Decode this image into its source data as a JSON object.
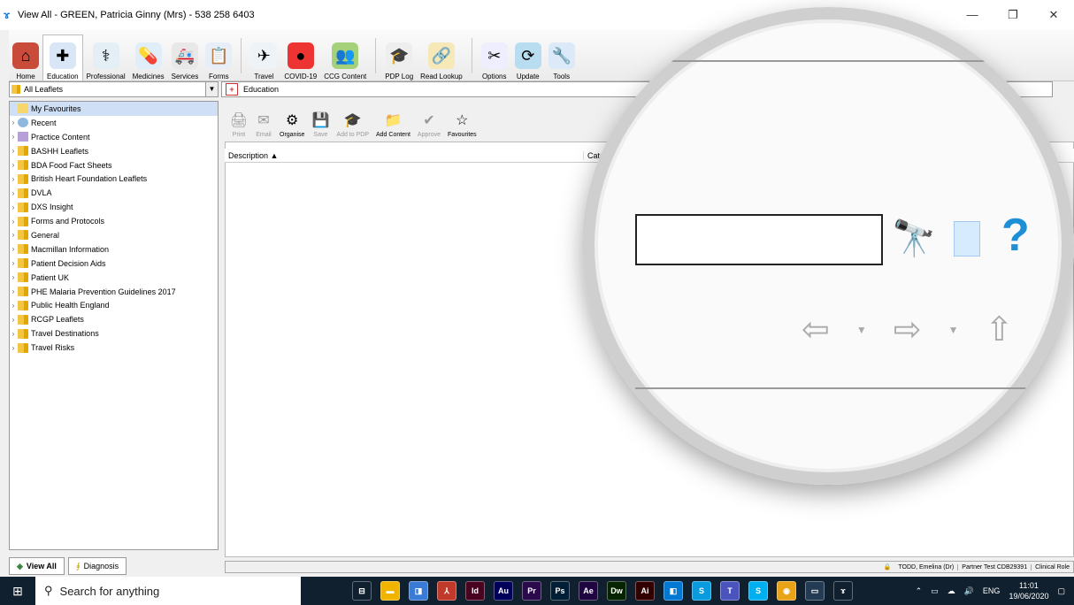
{
  "window": {
    "title": "View All  -  GREEN, Patricia Ginny (Mrs) - 538 258 6403",
    "buttons": [
      "—",
      "❐",
      "✕"
    ]
  },
  "ribbon": [
    {
      "label": "Home",
      "color": "#c94b3a",
      "glyph": "⌂"
    },
    {
      "label": "Education",
      "color": "#d8e6f5",
      "glyph": "✚",
      "active": true
    },
    {
      "label": "Professional",
      "color": "#e4eef5",
      "glyph": "⚕"
    },
    {
      "label": "Medicines",
      "color": "#dfeef8",
      "glyph": "💊"
    },
    {
      "label": "Services",
      "color": "#e8e8e8",
      "glyph": "🚑"
    },
    {
      "label": "Forms",
      "color": "#e8eef8",
      "glyph": "📋"
    },
    {
      "label": "Travel",
      "color": "#eef3f8",
      "glyph": "✈"
    },
    {
      "label": "COVID-19",
      "color": "#e33",
      "glyph": "●"
    },
    {
      "label": "CCG Content",
      "color": "#a6d17b",
      "glyph": "👥"
    },
    {
      "label": "PDP Log",
      "color": "#eee",
      "glyph": "🎓"
    },
    {
      "label": "Read Lookup",
      "color": "#f7e9b7",
      "glyph": "🔗"
    },
    {
      "label": "Options",
      "color": "#eef",
      "glyph": "✂"
    },
    {
      "label": "Update",
      "color": "#b8dcf0",
      "glyph": "⟳"
    },
    {
      "label": "Tools",
      "color": "#dbe9f8",
      "glyph": "🔧"
    }
  ],
  "leftPanel": {
    "combo": "All Leaflets",
    "tree": [
      {
        "label": "My Favourites",
        "type": "fav",
        "selected": true
      },
      {
        "label": "Recent",
        "type": "recent"
      },
      {
        "label": "Practice Content",
        "type": "practice"
      },
      {
        "label": "BASHH Leaflets",
        "type": "folder"
      },
      {
        "label": "BDA Food Fact Sheets",
        "type": "folder"
      },
      {
        "label": "British Heart Foundation Leaflets",
        "type": "folder"
      },
      {
        "label": "DVLA",
        "type": "folder"
      },
      {
        "label": "DXS Insight",
        "type": "folder"
      },
      {
        "label": "Forms and Protocols",
        "type": "folder"
      },
      {
        "label": "General",
        "type": "folder"
      },
      {
        "label": "Macmillan Information",
        "type": "folder"
      },
      {
        "label": "Patient Decision Aids",
        "type": "folder"
      },
      {
        "label": "Patient UK",
        "type": "folder"
      },
      {
        "label": "PHE Malaria Prevention Guidelines 2017",
        "type": "folder"
      },
      {
        "label": "Public Health England",
        "type": "folder"
      },
      {
        "label": "RCGP Leaflets",
        "type": "folder"
      },
      {
        "label": "Travel Destinations",
        "type": "folder"
      },
      {
        "label": "Travel Risks",
        "type": "folder"
      }
    ],
    "tabs": [
      "View All",
      "Diagnosis"
    ]
  },
  "main": {
    "header": "Education",
    "toolbar": [
      {
        "label": "Print",
        "disabled": true,
        "glyph": "🖨"
      },
      {
        "label": "Email",
        "disabled": true,
        "glyph": "✉"
      },
      {
        "label": "Organise",
        "disabled": false,
        "glyph": "⚙"
      },
      {
        "label": "Save",
        "disabled": true,
        "glyph": "💾"
      },
      {
        "label": "Add to PDP",
        "disabled": true,
        "glyph": "🎓"
      },
      {
        "label": "Add Content",
        "disabled": false,
        "glyph": "📁"
      },
      {
        "label": "Approve",
        "disabled": true,
        "glyph": "✔"
      },
      {
        "label": "Favourites",
        "disabled": false,
        "glyph": "☆"
      }
    ],
    "columns": [
      "Description ▲",
      "Category"
    ],
    "status": [
      "TODD, Emelina (Dr)",
      "Partner Test CDB29391",
      "Clinical Role"
    ]
  },
  "taskbar": {
    "search": "Search for anything",
    "apps": [
      {
        "t": "⊟",
        "c": "#10202e"
      },
      {
        "t": "▬",
        "c": "#f0b400"
      },
      {
        "t": "◨",
        "c": "#3a7bd5"
      },
      {
        "t": "⅄",
        "c": "#c0392b"
      },
      {
        "t": "Id",
        "c": "#49021f"
      },
      {
        "t": "Au",
        "c": "#00005b"
      },
      {
        "t": "Pr",
        "c": "#2a0a4a"
      },
      {
        "t": "Ps",
        "c": "#001e36"
      },
      {
        "t": "Ae",
        "c": "#1f0640"
      },
      {
        "t": "Dw",
        "c": "#072401"
      },
      {
        "t": "Ai",
        "c": "#330000"
      },
      {
        "t": "◧",
        "c": "#0078d4"
      },
      {
        "t": "S",
        "c": "#0a9ae0"
      },
      {
        "t": "T",
        "c": "#4b53bc"
      },
      {
        "t": "S",
        "c": "#00aff0"
      },
      {
        "t": "◉",
        "c": "#e8a317"
      },
      {
        "t": "▭",
        "c": "#233b53"
      },
      {
        "t": "ɤ",
        "c": "#10202e"
      }
    ],
    "tray": {
      "lang": "ENG",
      "time": "11:01",
      "date": "19/06/2020"
    }
  }
}
